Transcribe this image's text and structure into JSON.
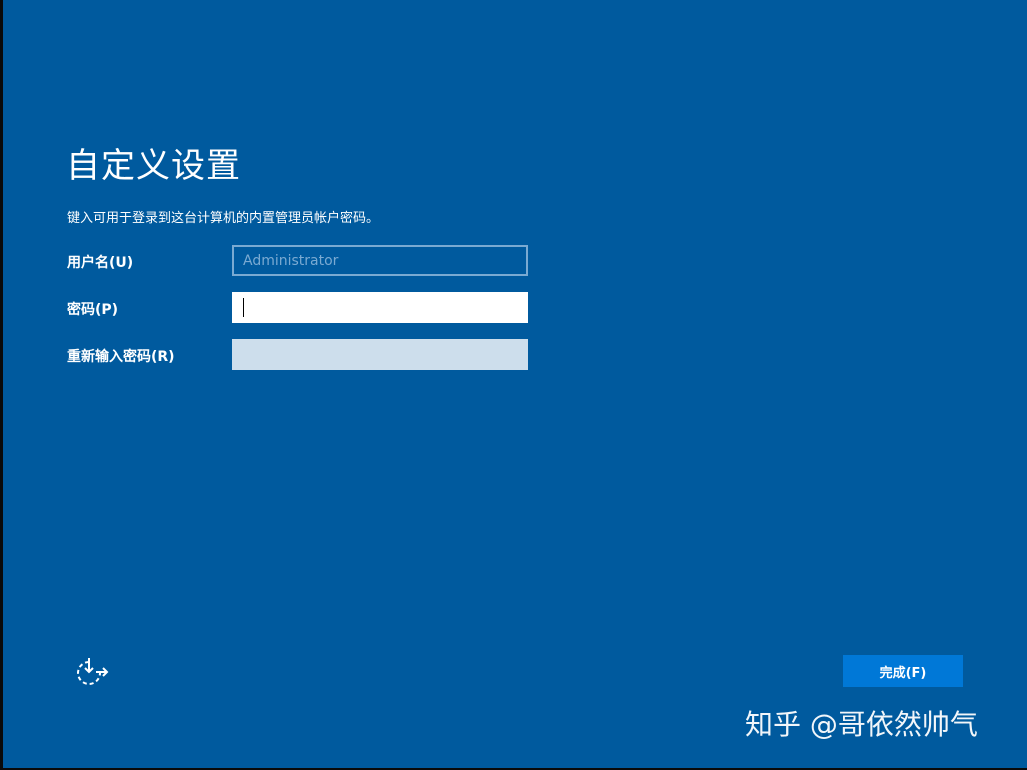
{
  "page": {
    "title": "自定义设置",
    "subtitle": "键入可用于登录到这台计算机的内置管理员帐户密码。"
  },
  "form": {
    "username_label": "用户名(U)",
    "username_placeholder": "Administrator",
    "password_label": "密码(P)",
    "password_value": "",
    "reenter_label": "重新输入密码(R)",
    "reenter_value": ""
  },
  "footer": {
    "accessibility_icon": "ease-of-access-icon",
    "finish_label": "完成(F)"
  },
  "watermark": "知乎 @哥依然帅气",
  "colors": {
    "background": "#005a9e",
    "button": "#0078d7",
    "disabled_field": "#cddeec",
    "username_border": "#7aaad2"
  }
}
